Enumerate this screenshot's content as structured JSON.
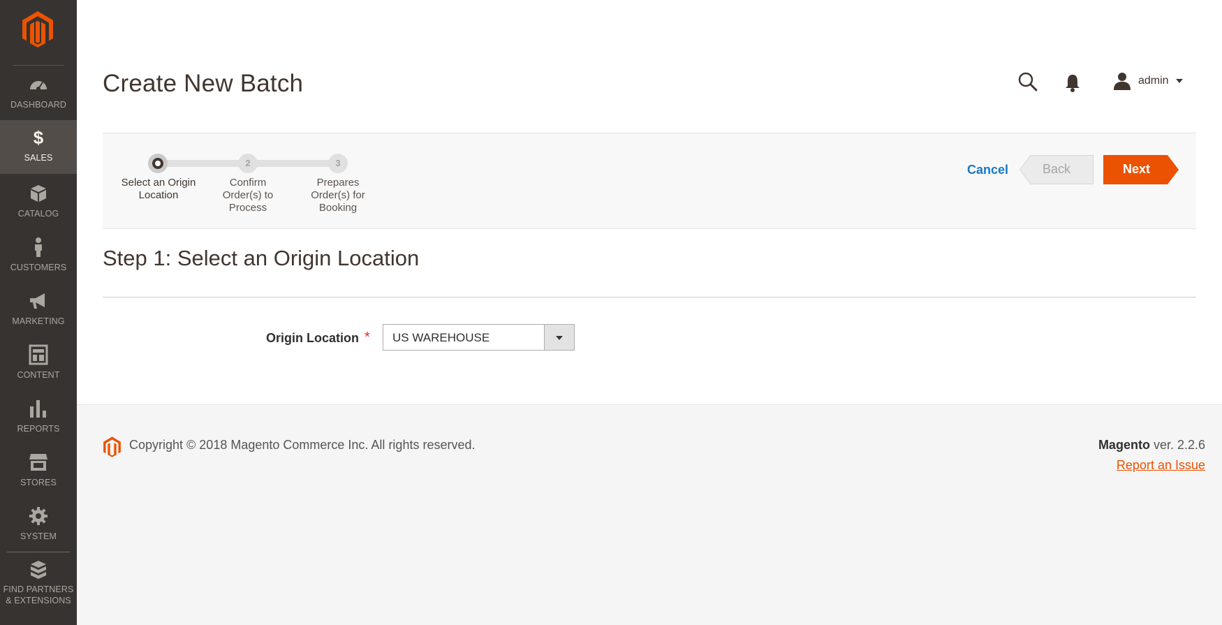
{
  "sidebar": {
    "items": [
      {
        "label": "DASHBOARD",
        "icon": "dashboard-icon"
      },
      {
        "label": "SALES",
        "icon": "dollar-icon"
      },
      {
        "label": "CATALOG",
        "icon": "cube-icon"
      },
      {
        "label": "CUSTOMERS",
        "icon": "person-icon"
      },
      {
        "label": "MARKETING",
        "icon": "megaphone-icon"
      },
      {
        "label": "CONTENT",
        "icon": "layout-icon"
      },
      {
        "label": "REPORTS",
        "icon": "bar-chart-icon"
      },
      {
        "label": "STORES",
        "icon": "storefront-icon"
      },
      {
        "label": "SYSTEM",
        "icon": "gear-icon"
      },
      {
        "label_line1": "FIND PARTNERS",
        "label_line2": "& EXTENSIONS",
        "icon": "boxes-icon"
      }
    ],
    "active": "SALES"
  },
  "header": {
    "title": "Create New Batch",
    "user": "admin"
  },
  "steps": [
    {
      "number": "",
      "label": "Select an Origin Location",
      "state": "current"
    },
    {
      "number": "2",
      "label": "Confirm Order(s) to Process",
      "state": "upcoming"
    },
    {
      "number": "3",
      "label": "Prepares Order(s) for Booking",
      "state": "upcoming"
    }
  ],
  "actions": {
    "cancel": "Cancel",
    "back": "Back",
    "next": "Next"
  },
  "form": {
    "heading": "Step 1: Select an Origin Location",
    "origin_label": "Origin Location",
    "required_mark": "*",
    "origin_value": "US WAREHOUSE"
  },
  "footer": {
    "copyright": "Copyright © 2018 Magento Commerce Inc. All rights reserved.",
    "brand": "Magento",
    "version": " ver. 2.2.6",
    "report": "Report an Issue"
  },
  "colors": {
    "accent": "#eb5202",
    "link": "#1979c3",
    "sidebar": "#373330"
  }
}
